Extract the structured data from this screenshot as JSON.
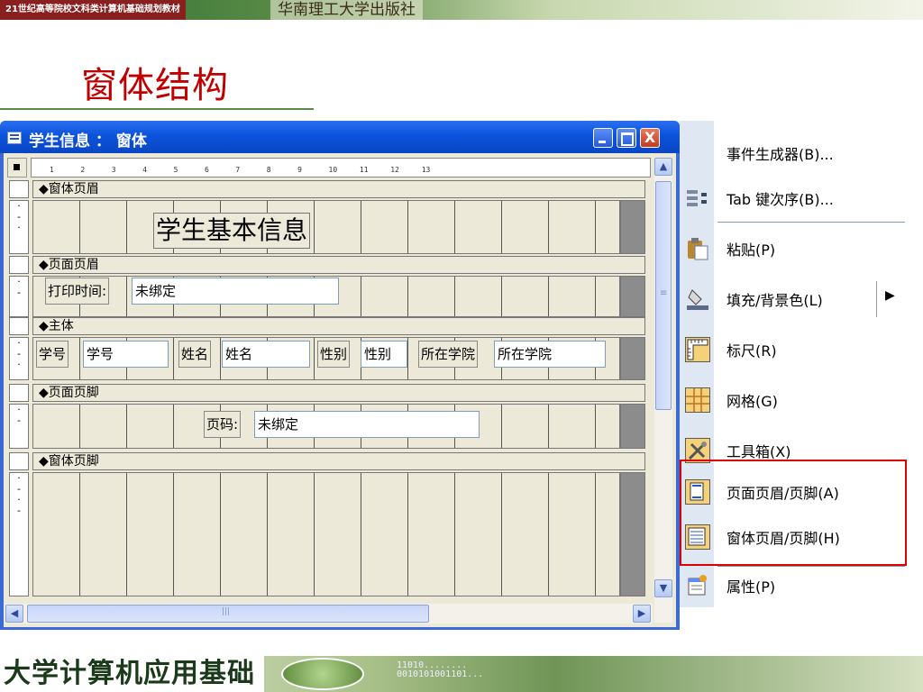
{
  "banner": {
    "series": "21世纪高等院校文科类计算机基础规划教材",
    "publisher": "华南理工大学出版社"
  },
  "slide": {
    "title": "窗体结构"
  },
  "window": {
    "title": "学生信息 ： 窗体",
    "close_glyph": "X"
  },
  "ruler": {
    "marks": [
      "1",
      "2",
      "3",
      "4",
      "5",
      "6",
      "7",
      "8",
      "9",
      "10",
      "11",
      "12",
      "13"
    ]
  },
  "form": {
    "sections": {
      "form_header": "◆窗体页眉",
      "page_header": "◆页面页眉",
      "detail": "◆主体",
      "page_footer": "◆页面页脚",
      "form_footer": "◆窗体页脚"
    },
    "heading": "学生基本信息",
    "print_time": {
      "label": "打印时间:",
      "value": "未绑定"
    },
    "fields": [
      {
        "label": "学号",
        "value": "学号"
      },
      {
        "label": "姓名",
        "value": "姓名"
      },
      {
        "label": "性别",
        "value": "性别"
      },
      {
        "label": "所在学院",
        "value": "所在学院"
      }
    ],
    "page_no": {
      "label": "页码:",
      "value": "未绑定"
    }
  },
  "context_menu": {
    "items": [
      {
        "label": "事件生成器(B)...",
        "icon": "event-builder-icon"
      },
      {
        "label": "Tab 键次序(B)...",
        "icon": "tab-order-icon"
      },
      {
        "label": "粘贴(P)",
        "icon": "paste-icon"
      },
      {
        "label": "填充/背景色(L)",
        "icon": "fill-color-icon"
      },
      {
        "label": "标尺(R)",
        "icon": "ruler-icon"
      },
      {
        "label": "网格(G)",
        "icon": "grid-icon"
      },
      {
        "label": "工具箱(X)",
        "icon": "toolbox-icon"
      },
      {
        "label": "页面页眉/页脚(A)",
        "icon": "page-header-footer-icon"
      },
      {
        "label": "窗体页眉/页脚(H)",
        "icon": "form-header-footer-icon"
      },
      {
        "label": "属性(P)",
        "icon": "properties-icon"
      }
    ],
    "submenu_arrow": "▶"
  },
  "footer": {
    "title": "大学计算机应用基础",
    "digits_line1": "11010........",
    "digits_line2": "0010101001101..."
  },
  "colors": {
    "title_red": "#c00000",
    "xp_blue": "#0b53db",
    "highlight": "#e00000"
  }
}
